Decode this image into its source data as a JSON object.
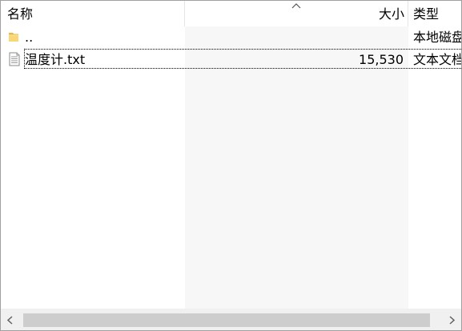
{
  "header": {
    "col_name": "名称",
    "col_size": "大小",
    "col_type": "类型",
    "sort_icon": "sort-ascending-icon"
  },
  "rows": [
    {
      "name": "..",
      "size": "",
      "type": "本地磁盘",
      "icon": "folder-icon"
    },
    {
      "name": "温度计.txt",
      "size": "15,530",
      "type": "文本文档",
      "icon": "text-file-icon"
    }
  ],
  "scrollbar": {
    "left_icon": "chevron-left-icon",
    "right_icon": "chevron-right-icon"
  },
  "colors": {
    "size_column_bg": "#f7f7f7",
    "scroll_track": "#f0f0f0",
    "scroll_thumb": "#cdcdcd",
    "folder": "#f8d775"
  }
}
